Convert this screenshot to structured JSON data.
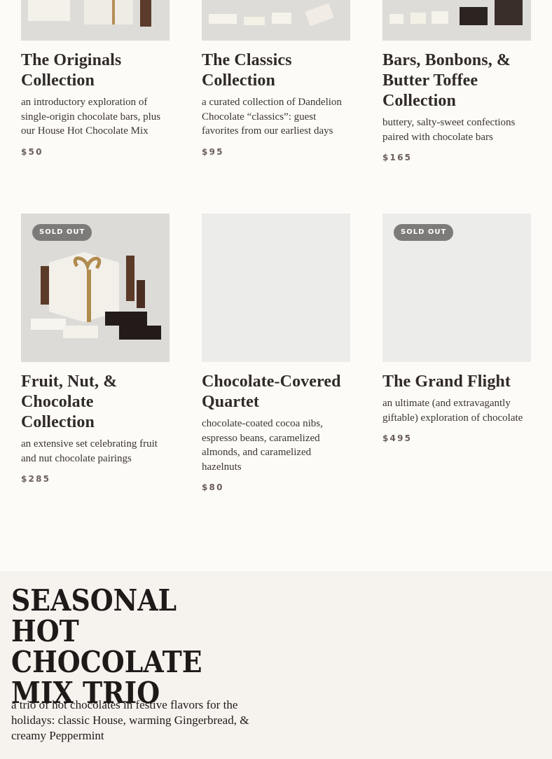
{
  "products": [
    {
      "title": "The Originals Collection",
      "description": "an introductory exploration of single-origin chocolate bars, plus our House Hot Chocolate Mix",
      "price": "$50",
      "badge": ""
    },
    {
      "title": "The Classics Collection",
      "description": "a curated collection of Dandelion Chocolate “classics”: guest favorites from our earliest days",
      "price": "$95",
      "badge": ""
    },
    {
      "title": "Bars, Bonbons, & Butter Toffee Collection",
      "description": "buttery, salty-sweet confections paired with chocolate bars",
      "price": "$165",
      "badge": ""
    },
    {
      "title": "Fruit, Nut, & Chocolate Collection",
      "description": "an extensive set celebrating fruit and nut chocolate pairings",
      "price": "$285",
      "badge": "SOLD OUT"
    },
    {
      "title": "Chocolate-Covered Quartet",
      "description": "chocolate-coated cocoa nibs, espresso beans, caramelized almonds, and caramelized hazelnuts",
      "price": "$80",
      "badge": ""
    },
    {
      "title": "The Grand Flight",
      "description": "an ultimate (and extravagantly giftable) exploration of chocolate",
      "price": "$495",
      "badge": "SOLD OUT"
    }
  ],
  "seasonal": {
    "heading": "Seasonal Hot Chocolate Mix Trio",
    "description": "a trio of hot chocolates in festive flavors for the holidays: classic House, warming Gingerbread, & creamy Peppermint"
  }
}
